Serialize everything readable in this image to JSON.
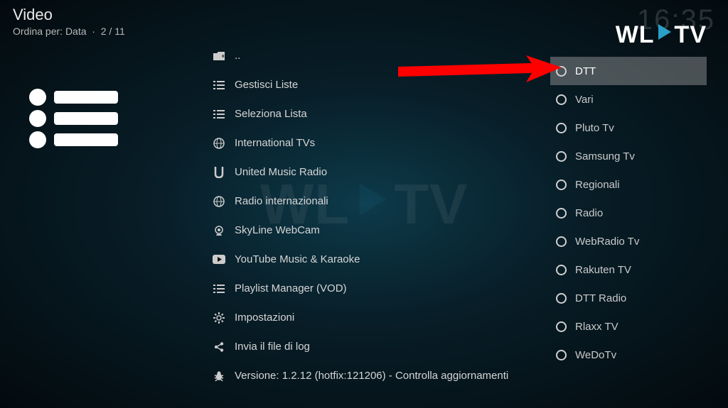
{
  "header": {
    "title": "Video",
    "sort_prefix": "Ordina per:",
    "sort_value": "Data",
    "position": "2 / 11"
  },
  "clock": "16:35",
  "logo": {
    "text_left": "WL",
    "text_right": "TV"
  },
  "main_menu": [
    {
      "icon": "folder-up",
      "label": ".."
    },
    {
      "icon": "list",
      "label": "Gestisci Liste"
    },
    {
      "icon": "list",
      "label": "Seleziona Lista"
    },
    {
      "icon": "globe",
      "label": "International TVs"
    },
    {
      "icon": "music-u",
      "label": "United Music Radio"
    },
    {
      "icon": "globe",
      "label": "Radio internazionali"
    },
    {
      "icon": "webcam",
      "label": "SkyLine WebCam"
    },
    {
      "icon": "youtube",
      "label": "YouTube Music & Karaoke"
    },
    {
      "icon": "list",
      "label": "Playlist Manager (VOD)"
    },
    {
      "icon": "gear",
      "label": "Impostazioni"
    },
    {
      "icon": "share",
      "label": "Invia il file di log"
    },
    {
      "icon": "bug",
      "label": "Versione: 1.2.12 (hotfix:121206) - Controlla aggiornamenti"
    }
  ],
  "side_menu": [
    {
      "label": "DTT",
      "selected": true
    },
    {
      "label": "Vari",
      "selected": false
    },
    {
      "label": "Pluto Tv",
      "selected": false
    },
    {
      "label": "Samsung Tv",
      "selected": false
    },
    {
      "label": "Regionali",
      "selected": false
    },
    {
      "label": "Radio",
      "selected": false
    },
    {
      "label": "WebRadio Tv",
      "selected": false
    },
    {
      "label": "Rakuten TV",
      "selected": false
    },
    {
      "label": "DTT Radio",
      "selected": false
    },
    {
      "label": "Rlaxx TV",
      "selected": false
    },
    {
      "label": "WeDoTv",
      "selected": false
    }
  ]
}
